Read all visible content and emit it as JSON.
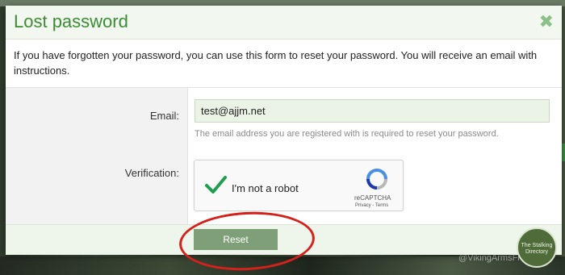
{
  "modal": {
    "title": "Lost password",
    "close_symbol": "✖",
    "intro": "If you have forgotten your password, you can use this form to reset your password. You will receive an email with instructions."
  },
  "form": {
    "email_label": "Email:",
    "email_value": "test@ajjm.net",
    "email_hint": "The email address you are registered with is required to reset your password.",
    "verification_label": "Verification:"
  },
  "captcha": {
    "checked": true,
    "label": "I'm not a robot",
    "brand": "reCAPTCHA",
    "links": "Privacy - Terms"
  },
  "footer": {
    "reset_label": "Reset"
  },
  "background": {
    "handle_text": "@VikingArmsFi"
  },
  "badge": {
    "text": "The Stalking Directory"
  },
  "colors": {
    "title_green": "#3d8b35",
    "button_green": "#7f9f78",
    "annotation_red": "#d5211c"
  },
  "icons": {
    "close": "close-icon",
    "checkmark": "checkmark-icon",
    "recaptcha": "recaptcha-logo-icon"
  }
}
